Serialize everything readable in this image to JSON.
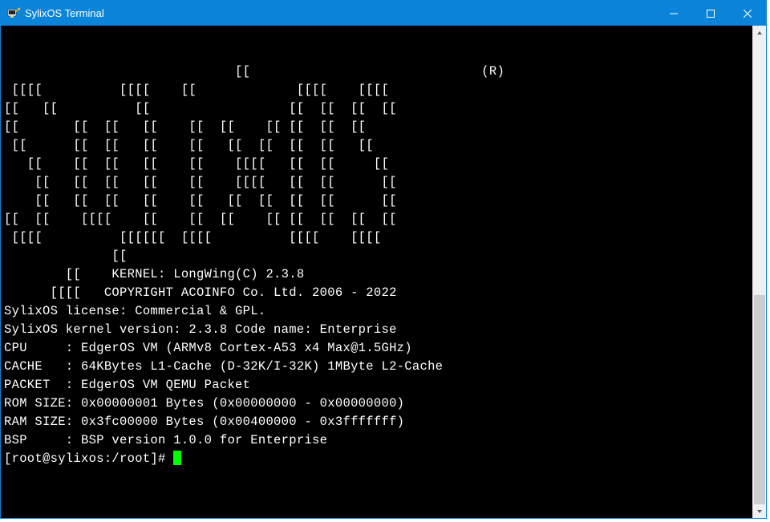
{
  "window": {
    "title": "SylixOS Terminal"
  },
  "terminal": {
    "ascii_block": "\n\n                              [[                              (R)\n [[[[          [[[[    [[             [[[[    [[[[\n[[   [[          [[                  [[  [[  [[  [[\n[[       [[  [[   [[    [[  [[    [[ [[  [[  [[\n [[      [[  [[   [[    [[   [[  [[  [[  [[   [[\n   [[    [[  [[   [[    [[    [[[[   [[  [[     [[\n    [[   [[  [[   [[    [[    [[[[   [[  [[      [[\n    [[   [[  [[   [[    [[   [[  [[  [[  [[      [[\n[[  [[    [[[[    [[    [[  [[    [[ [[  [[  [[  [[\n [[[[          [[[[[[  [[[[          [[[[    [[[[\n              [[\n        [[    KERNEL: LongWing(C) 2.3.8\n      [[[[   COPYRIGHT ACOINFO Co. Ltd. 2006 - 2022",
    "license_line": "SylixOS license: Commercial & GPL.",
    "version_line": "SylixOS kernel version: 2.3.8 Code name: Enterprise",
    "info_lines": {
      "cpu": "CPU     : EdgerOS VM (ARMv8 Cortex-A53 x4 Max@1.5GHz)",
      "cache": "CACHE   : 64KBytes L1-Cache (D-32K/I-32K) 1MByte L2-Cache",
      "packet": "PACKET  : EdgerOS VM QEMU Packet",
      "rom_size": "ROM SIZE: 0x00000001 Bytes (0x00000000 - 0x00000000)",
      "ram_size": "RAM SIZE: 0x3fc00000 Bytes (0x00400000 - 0x3fffffff)",
      "bsp": "BSP     : BSP version 1.0.0 for Enterprise"
    },
    "prompt": "[root@sylixos:/root]# "
  }
}
